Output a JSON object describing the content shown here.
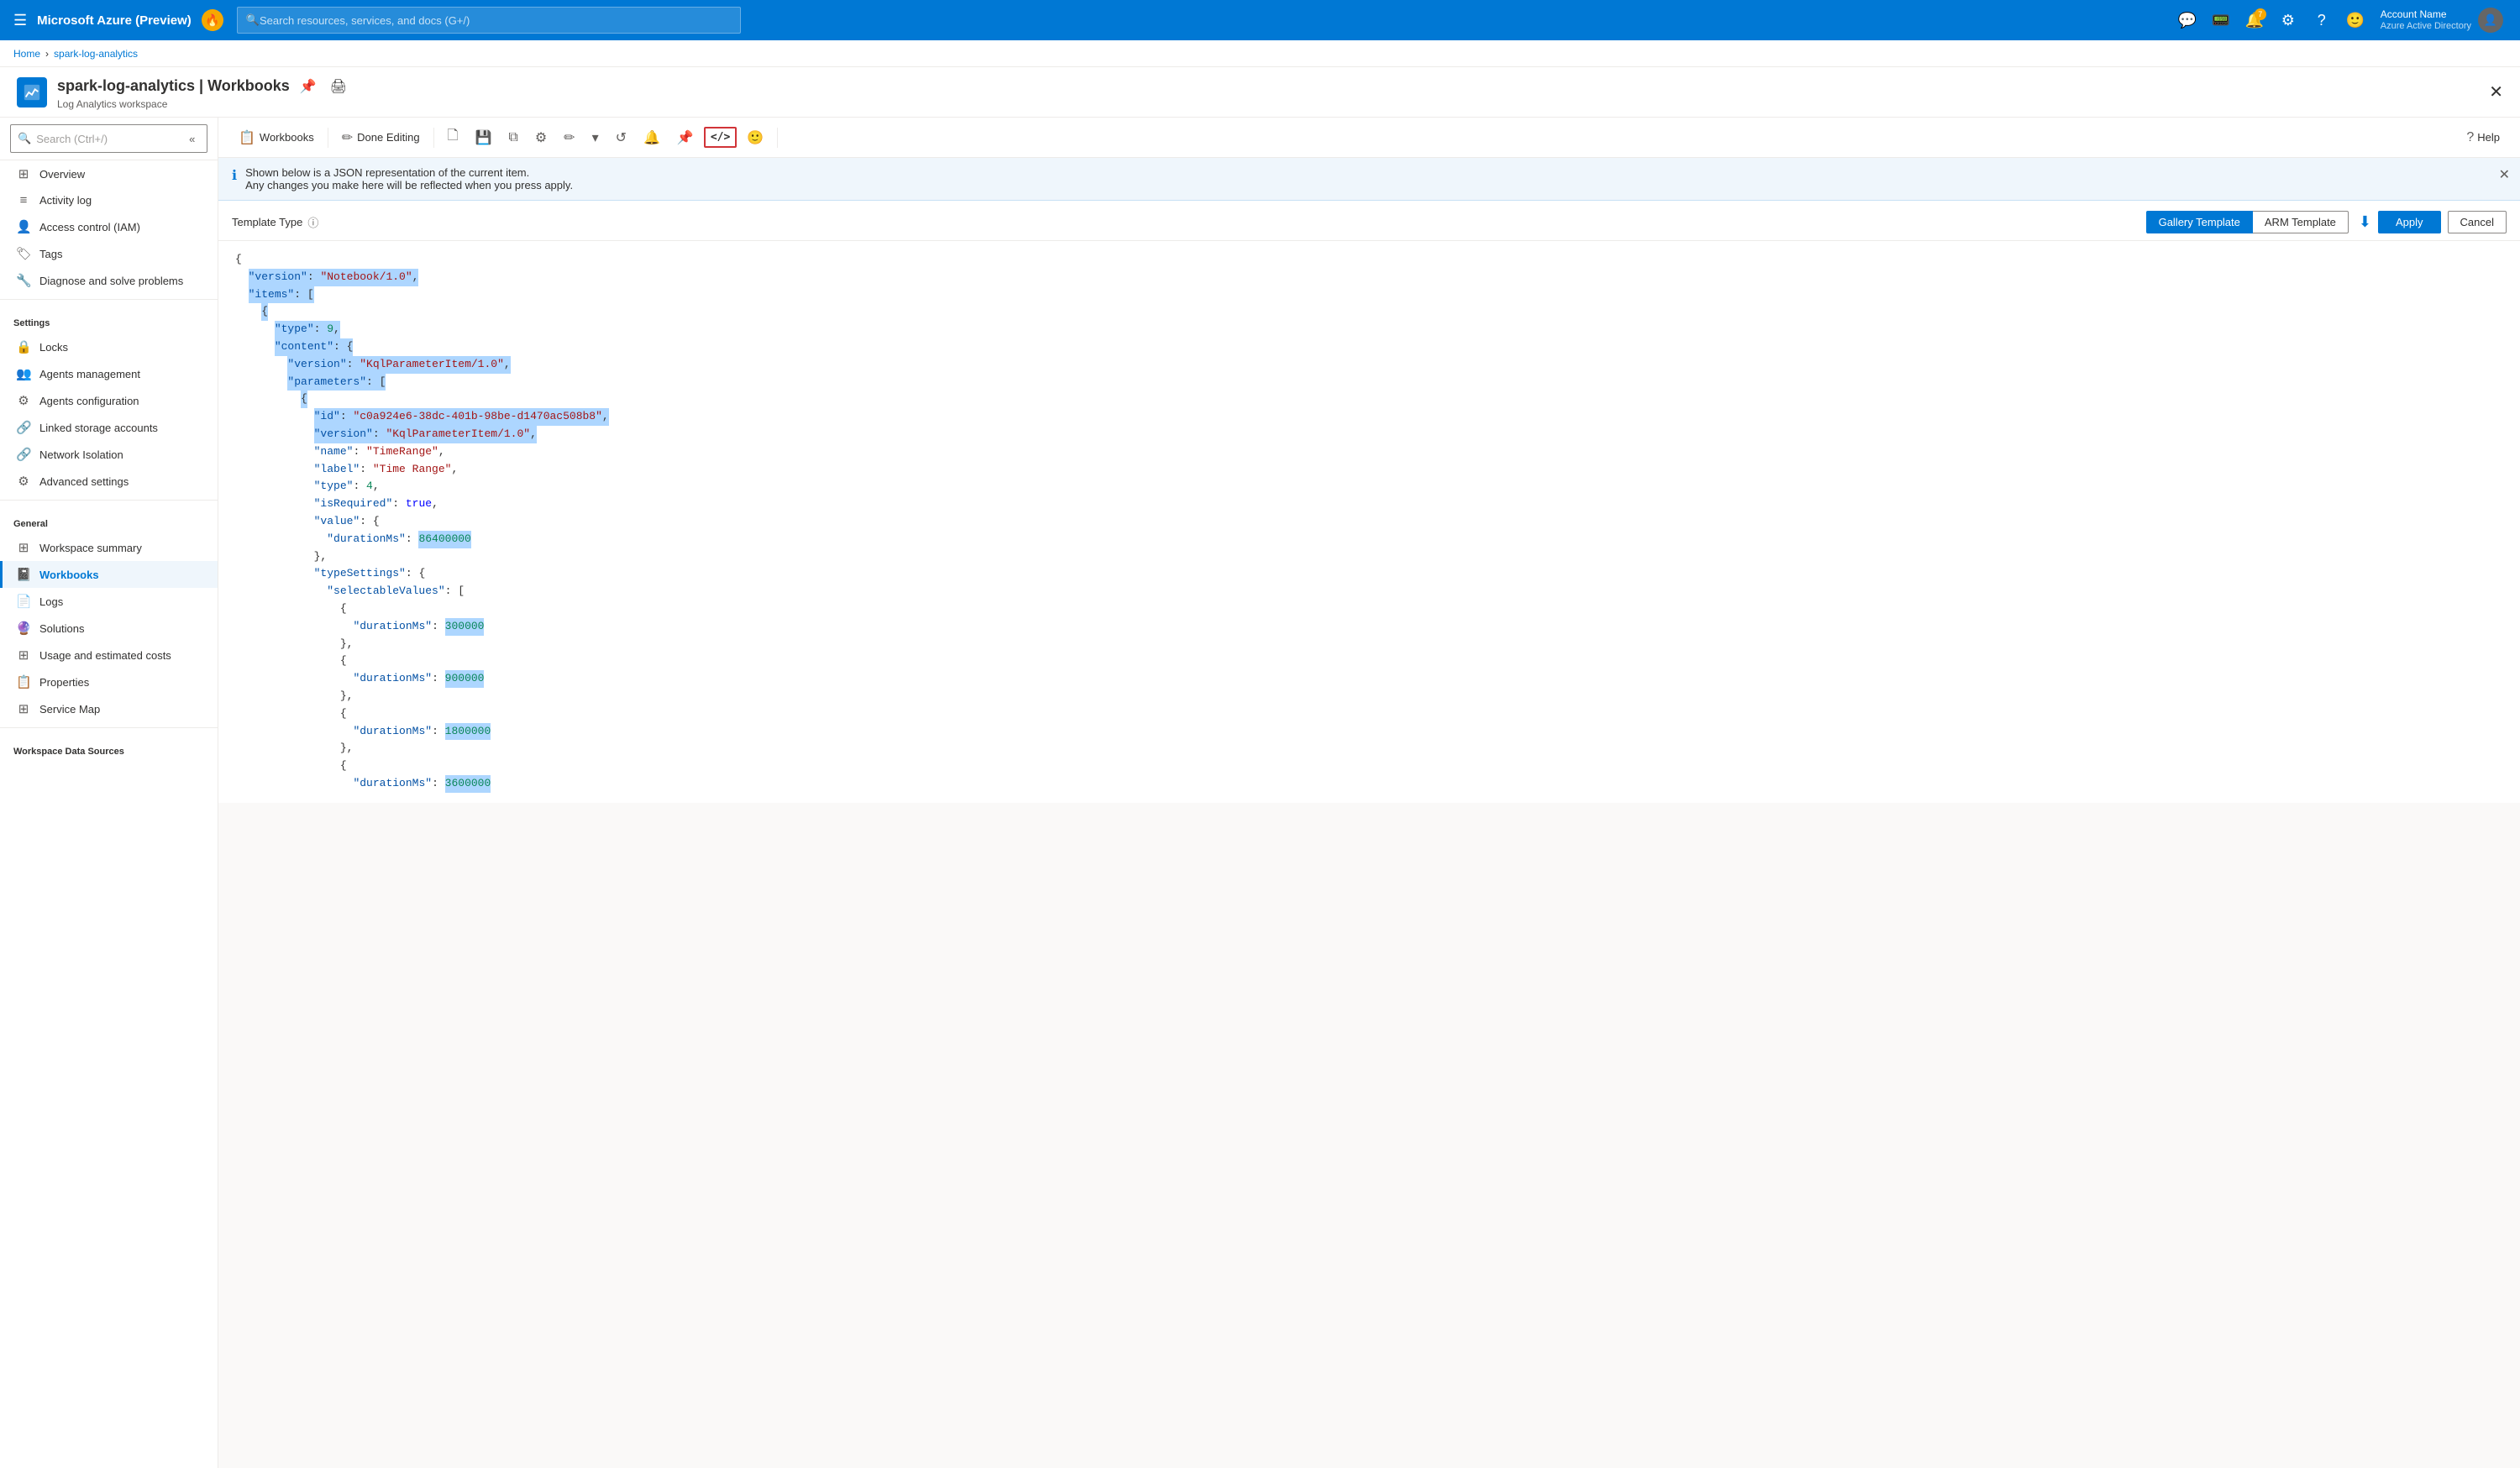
{
  "topbar": {
    "title": "Microsoft Azure (Preview)",
    "search_placeholder": "Search resources, services, and docs (G+/)",
    "hamburger_icon": "☰",
    "badge_icon": "🔥",
    "notification_count": "7",
    "user_name": "Account Name",
    "user_subtitle": "Azure Active Directory"
  },
  "breadcrumb": {
    "home": "Home",
    "resource": "spark-log-analytics"
  },
  "resource_header": {
    "title": "spark-log-analytics | Workbooks",
    "subtitle": "Log Analytics workspace",
    "pin_icon": "📌",
    "print_icon": "🖨"
  },
  "sidebar": {
    "search_placeholder": "Search (Ctrl+/)",
    "items": [
      {
        "id": "overview",
        "label": "Overview",
        "icon": "⊞",
        "section": null
      },
      {
        "id": "activity-log",
        "label": "Activity log",
        "icon": "≡",
        "section": null
      },
      {
        "id": "iam",
        "label": "Access control (IAM)",
        "icon": "👤",
        "section": null
      },
      {
        "id": "tags",
        "label": "Tags",
        "icon": "🏷",
        "section": null
      },
      {
        "id": "diagnose",
        "label": "Diagnose and solve problems",
        "icon": "🔧",
        "section": null
      },
      {
        "id": "settings-header",
        "label": "Settings",
        "type": "section"
      },
      {
        "id": "locks",
        "label": "Locks",
        "icon": "🔒",
        "section": "Settings"
      },
      {
        "id": "agents-management",
        "label": "Agents management",
        "icon": "👥",
        "section": "Settings"
      },
      {
        "id": "agents-config",
        "label": "Agents configuration",
        "icon": "⚙",
        "section": "Settings"
      },
      {
        "id": "linked-storage",
        "label": "Linked storage accounts",
        "icon": "🔗",
        "section": "Settings"
      },
      {
        "id": "network-isolation",
        "label": "Network Isolation",
        "icon": "🔗",
        "section": "Settings"
      },
      {
        "id": "advanced-settings",
        "label": "Advanced settings",
        "icon": "⚙",
        "section": "Settings"
      },
      {
        "id": "general-header",
        "label": "General",
        "type": "section"
      },
      {
        "id": "workspace-summary",
        "label": "Workspace summary",
        "icon": "⊞",
        "section": "General"
      },
      {
        "id": "workbooks",
        "label": "Workbooks",
        "icon": "📓",
        "section": "General",
        "active": true
      },
      {
        "id": "logs",
        "label": "Logs",
        "icon": "📄",
        "section": "General"
      },
      {
        "id": "solutions",
        "label": "Solutions",
        "icon": "🔮",
        "section": "General"
      },
      {
        "id": "usage-costs",
        "label": "Usage and estimated costs",
        "icon": "⊞",
        "section": "General"
      },
      {
        "id": "properties",
        "label": "Properties",
        "icon": "📋",
        "section": "General"
      },
      {
        "id": "service-map",
        "label": "Service Map",
        "icon": "⊞",
        "section": "General"
      },
      {
        "id": "workspace-data-header",
        "label": "Workspace Data Sources",
        "type": "section"
      }
    ]
  },
  "toolbar": {
    "workbooks_label": "Workbooks",
    "done_editing_label": "Done Editing",
    "help_label": "Help",
    "buttons": [
      {
        "id": "workbooks-btn",
        "icon": "📋",
        "label": "Workbooks"
      },
      {
        "id": "done-editing-btn",
        "icon": "✏",
        "label": "Done Editing"
      },
      {
        "id": "new-btn",
        "icon": "🗋",
        "label": ""
      },
      {
        "id": "save-btn",
        "icon": "💾",
        "label": ""
      },
      {
        "id": "clone-btn",
        "icon": "⧉",
        "label": ""
      },
      {
        "id": "settings-btn",
        "icon": "⚙",
        "label": ""
      },
      {
        "id": "edit-btn",
        "icon": "✏",
        "label": ""
      },
      {
        "id": "dropdown-btn",
        "icon": "▾",
        "label": ""
      },
      {
        "id": "refresh-btn",
        "icon": "↺",
        "label": ""
      },
      {
        "id": "notification-btn",
        "icon": "🔔",
        "label": ""
      },
      {
        "id": "pin-btn",
        "icon": "📌",
        "label": ""
      },
      {
        "id": "code-btn",
        "icon": "</>",
        "label": "",
        "highlighted": true
      },
      {
        "id": "emoji-btn",
        "icon": "🙂",
        "label": ""
      },
      {
        "id": "help-btn",
        "icon": "?",
        "label": "Help"
      }
    ]
  },
  "info_banner": {
    "text_line1": "Shown below is a JSON representation of the current item.",
    "text_line2": "Any changes you make here will be reflected when you press apply."
  },
  "template_type": {
    "label": "Template Type",
    "tabs": [
      {
        "id": "gallery-template",
        "label": "Gallery Template",
        "active": true
      },
      {
        "id": "arm-template",
        "label": "ARM Template",
        "active": false
      }
    ],
    "apply_label": "Apply",
    "cancel_label": "Cancel"
  },
  "json_content": {
    "lines": [
      {
        "indent": 0,
        "content": "{",
        "type": "brace"
      },
      {
        "indent": 1,
        "content": "\"version\": \"Notebook/1.0\",",
        "type": "key-string",
        "key": "version",
        "value": "Notebook/1.0"
      },
      {
        "indent": 1,
        "content": "\"items\": [",
        "type": "key-brace",
        "key": "items"
      },
      {
        "indent": 2,
        "content": "{",
        "type": "brace"
      },
      {
        "indent": 3,
        "content": "\"type\": 9,",
        "type": "key-number",
        "key": "type",
        "value": "9"
      },
      {
        "indent": 3,
        "content": "\"content\": {",
        "type": "key-brace",
        "key": "content"
      },
      {
        "indent": 4,
        "content": "\"version\": \"KqlParameterItem/1.0\",",
        "type": "key-string",
        "key": "version",
        "value": "KqlParameterItem/1.0"
      },
      {
        "indent": 4,
        "content": "\"parameters\": [",
        "type": "key-brace",
        "key": "parameters"
      },
      {
        "indent": 5,
        "content": "{",
        "type": "brace"
      },
      {
        "indent": 6,
        "content": "\"id\": \"c0a924e6-38dc-401b-98be-d1470ac508b8\",",
        "type": "key-string",
        "key": "id",
        "value": "c0a924e6-38dc-401b-98be-d1470ac508b8",
        "highlight": true
      },
      {
        "indent": 6,
        "content": "\"version\": \"KqlParameterItem/1.0\",",
        "type": "key-string",
        "key": "version",
        "value": "KqlParameterItem/1.0",
        "highlight": true
      },
      {
        "indent": 6,
        "content": "\"name\": \"TimeRange\",",
        "type": "key-string",
        "key": "name",
        "value": "TimeRange"
      },
      {
        "indent": 6,
        "content": "\"label\": \"Time Range\",",
        "type": "key-string",
        "key": "label",
        "value": "Time Range"
      },
      {
        "indent": 6,
        "content": "\"type\": 4,",
        "type": "key-number",
        "key": "type",
        "value": "4"
      },
      {
        "indent": 6,
        "content": "\"isRequired\": true,",
        "type": "key-bool",
        "key": "isRequired",
        "value": "true"
      },
      {
        "indent": 6,
        "content": "\"value\": {",
        "type": "key-brace",
        "key": "value"
      },
      {
        "indent": 7,
        "content": "\"durationMs\": 86400000",
        "type": "key-number",
        "key": "durationMs",
        "value": "86400000"
      },
      {
        "indent": 6,
        "content": "},",
        "type": "brace"
      },
      {
        "indent": 6,
        "content": "\"typeSettings\": {",
        "type": "key-brace",
        "key": "typeSettings"
      },
      {
        "indent": 7,
        "content": "\"selectableValues\": [",
        "type": "key-brace",
        "key": "selectableValues"
      },
      {
        "indent": 8,
        "content": "{",
        "type": "brace"
      },
      {
        "indent": 9,
        "content": "\"durationMs\": 300000",
        "type": "key-number",
        "key": "durationMs",
        "value": "300000"
      },
      {
        "indent": 8,
        "content": "},",
        "type": "brace"
      },
      {
        "indent": 8,
        "content": "{",
        "type": "brace"
      },
      {
        "indent": 9,
        "content": "\"durationMs\": 900000",
        "type": "key-number",
        "key": "durationMs",
        "value": "900000"
      },
      {
        "indent": 8,
        "content": "},",
        "type": "brace"
      },
      {
        "indent": 8,
        "content": "{",
        "type": "brace"
      },
      {
        "indent": 9,
        "content": "\"durationMs\": 1800000",
        "type": "key-number",
        "key": "durationMs",
        "value": "1800000"
      },
      {
        "indent": 8,
        "content": "},",
        "type": "brace"
      },
      {
        "indent": 8,
        "content": "{",
        "type": "brace"
      },
      {
        "indent": 9,
        "content": "\"durationMs\": 3600000",
        "type": "key-number",
        "key": "durationMs",
        "value": "3600000"
      }
    ]
  }
}
